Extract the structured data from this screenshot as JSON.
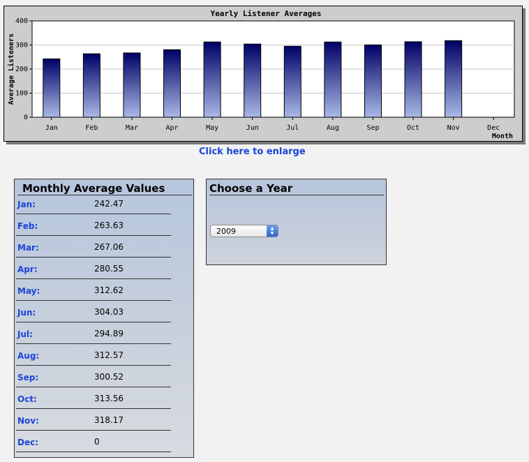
{
  "chart": {
    "link_text": "Click here to enlarge"
  },
  "chart_data": {
    "type": "bar",
    "title": "Yearly Listener Averages",
    "xlabel": "Month",
    "ylabel": "Average Listeners",
    "categories": [
      "Jan",
      "Feb",
      "Mar",
      "Apr",
      "May",
      "Jun",
      "Jul",
      "Aug",
      "Sep",
      "Oct",
      "Nov",
      "Dec"
    ],
    "values": [
      242.47,
      263.63,
      267.06,
      280.55,
      312.62,
      304.03,
      294.89,
      312.57,
      300.52,
      313.56,
      318.17,
      0
    ],
    "ylim": [
      0,
      400
    ],
    "yticks": [
      0,
      100,
      200,
      300,
      400
    ],
    "grid": true,
    "legend": "none",
    "colors": {
      "bar_top": "#000066",
      "bar_bottom": "#a9b9e6",
      "plot_bg": "#ffffff",
      "panel_bg": "#cdcdcd"
    }
  },
  "monthly": {
    "title": "Monthly Average Values",
    "rows": [
      {
        "label": "Jan:",
        "value": "242.47"
      },
      {
        "label": "Feb:",
        "value": "263.63"
      },
      {
        "label": "Mar:",
        "value": "267.06"
      },
      {
        "label": "Apr:",
        "value": "280.55"
      },
      {
        "label": "May:",
        "value": "312.62"
      },
      {
        "label": "Jun:",
        "value": "304.03"
      },
      {
        "label": "Jul:",
        "value": "294.89"
      },
      {
        "label": "Aug:",
        "value": "312.57"
      },
      {
        "label": "Sep:",
        "value": "300.52"
      },
      {
        "label": "Oct:",
        "value": "313.56"
      },
      {
        "label": "Nov:",
        "value": "318.17"
      },
      {
        "label": "Dec:",
        "value": "0"
      }
    ]
  },
  "year_picker": {
    "title": "Choose a Year",
    "selected": "2009"
  },
  "colors": {
    "link": "#1b45d8",
    "page_bg": "#f2f2f2"
  }
}
